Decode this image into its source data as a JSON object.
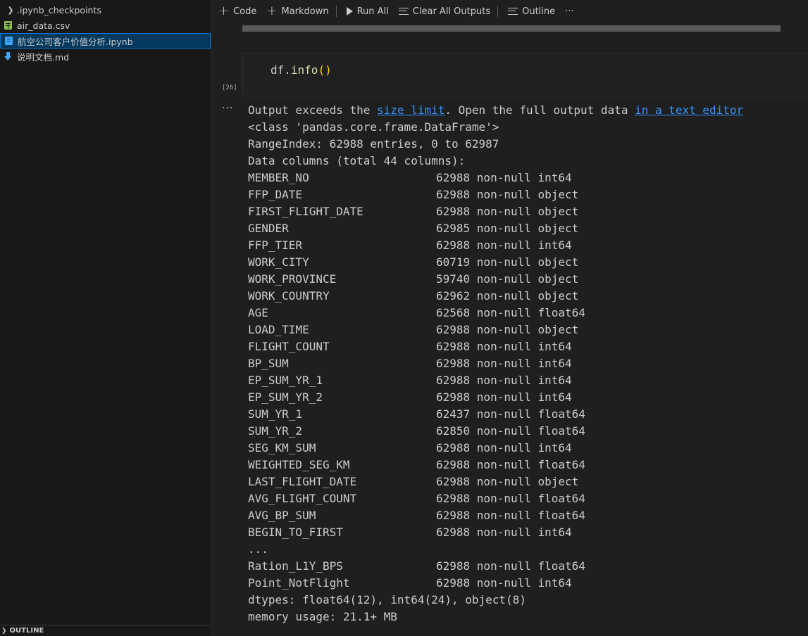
{
  "explorer": {
    "items": [
      {
        "label": ".ipynb_checkpoints",
        "type": "folder"
      },
      {
        "label": "air_data.csv",
        "type": "csv"
      },
      {
        "label": "航空公司客户价值分析.ipynb",
        "type": "notebook",
        "selected": true
      },
      {
        "label": "说明文档.md",
        "type": "markdown"
      }
    ],
    "outline_label": "OUTLINE"
  },
  "toolbar": {
    "code": "Code",
    "markdown": "Markdown",
    "run_all": "Run All",
    "clear_all": "Clear All Outputs",
    "outline": "Outline",
    "more": "···"
  },
  "cell": {
    "execution_count": "[26]",
    "code_obj": "df.",
    "code_fn": "info",
    "code_parens": "()"
  },
  "output": {
    "more": "···",
    "notice_prefix": "Output exceeds the ",
    "notice_link1": "size limit",
    "notice_mid": ". Open the full output data ",
    "notice_link2": "in a text editor",
    "class_line": "<class 'pandas.core.frame.DataFrame'>",
    "range_line": "RangeIndex: 62988 entries, 0 to 62987",
    "columns_header": "Data columns (total 44 columns):",
    "columns": [
      {
        "name": "MEMBER_NO",
        "info": "62988 non-null int64"
      },
      {
        "name": "FFP_DATE",
        "info": "62988 non-null object"
      },
      {
        "name": "FIRST_FLIGHT_DATE",
        "info": "62988 non-null object"
      },
      {
        "name": "GENDER",
        "info": "62985 non-null object"
      },
      {
        "name": "FFP_TIER",
        "info": "62988 non-null int64"
      },
      {
        "name": "WORK_CITY",
        "info": "60719 non-null object"
      },
      {
        "name": "WORK_PROVINCE",
        "info": "59740 non-null object"
      },
      {
        "name": "WORK_COUNTRY",
        "info": "62962 non-null object"
      },
      {
        "name": "AGE",
        "info": "62568 non-null float64"
      },
      {
        "name": "LOAD_TIME",
        "info": "62988 non-null object"
      },
      {
        "name": "FLIGHT_COUNT",
        "info": "62988 non-null int64"
      },
      {
        "name": "BP_SUM",
        "info": "62988 non-null int64"
      },
      {
        "name": "EP_SUM_YR_1",
        "info": "62988 non-null int64"
      },
      {
        "name": "EP_SUM_YR_2",
        "info": "62988 non-null int64"
      },
      {
        "name": "SUM_YR_1",
        "info": "62437 non-null float64"
      },
      {
        "name": "SUM_YR_2",
        "info": "62850 non-null float64"
      },
      {
        "name": "SEG_KM_SUM",
        "info": "62988 non-null int64"
      },
      {
        "name": "WEIGHTED_SEG_KM",
        "info": "62988 non-null float64"
      },
      {
        "name": "LAST_FLIGHT_DATE",
        "info": "62988 non-null object"
      },
      {
        "name": "AVG_FLIGHT_COUNT",
        "info": "62988 non-null float64"
      },
      {
        "name": "AVG_BP_SUM",
        "info": "62988 non-null float64"
      },
      {
        "name": "BEGIN_TO_FIRST",
        "info": "62988 non-null int64"
      }
    ],
    "ellipsis": "...",
    "tail_columns": [
      {
        "name": "Ration_L1Y_BPS",
        "info": "62988 non-null float64"
      },
      {
        "name": "Point_NotFlight",
        "info": "62988 non-null int64"
      }
    ],
    "dtypes_line": "dtypes: float64(12), int64(24), object(8)",
    "memory_line": "memory usage: 21.1+ MB"
  }
}
